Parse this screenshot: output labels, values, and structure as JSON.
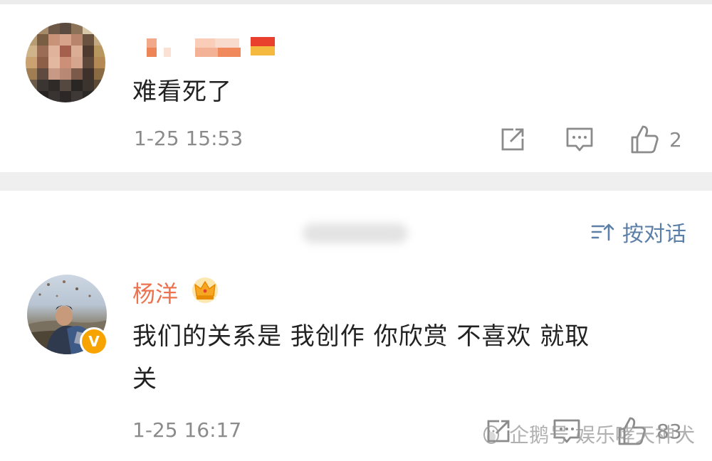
{
  "comments": [
    {
      "text": "难看死了",
      "time": "1-25 15:53",
      "likes": "2"
    },
    {
      "username": "杨洋",
      "text_line1": "我们的关系是 我创作 你欣赏 不喜欢 就取",
      "text_line2": "关",
      "time": "1-25 16:17",
      "likes": "83"
    }
  ],
  "sort": {
    "label": "按对话"
  },
  "watermark": {
    "text": "企鹅号 娱乐哮天神犬"
  },
  "colors": {
    "username": "#eb7350",
    "accent": "#5b7fa6",
    "muted": "#8b8b8b",
    "verified": "#f7a400"
  },
  "icons": [
    "repost-icon",
    "comment-icon",
    "like-icon",
    "sort-icon",
    "crown-icon",
    "verified-icon",
    "penguin-icon"
  ]
}
